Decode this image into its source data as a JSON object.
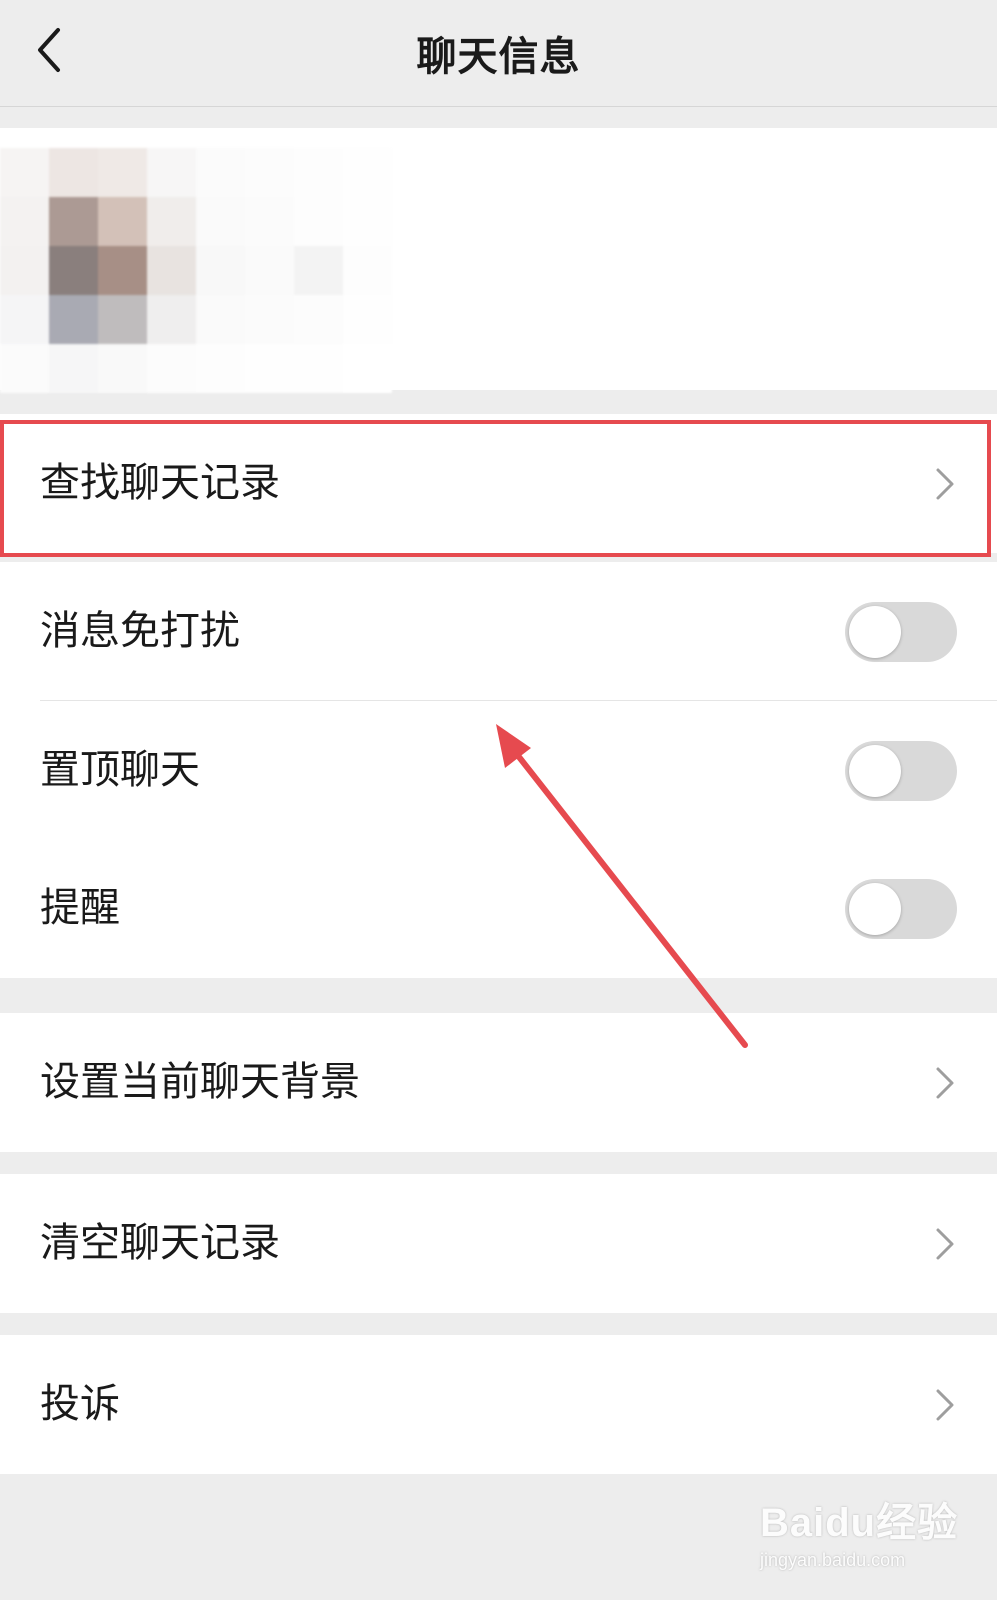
{
  "header": {
    "title": "聊天信息",
    "back_icon": "chevron-left-icon"
  },
  "rows": {
    "search_history": {
      "label": "查找聊天记录"
    },
    "mute": {
      "label": "消息免打扰",
      "enabled": false
    },
    "pin": {
      "label": "置顶聊天",
      "enabled": false
    },
    "remind": {
      "label": "提醒",
      "enabled": false
    },
    "background": {
      "label": "设置当前聊天背景"
    },
    "clear_history": {
      "label": "清空聊天记录"
    },
    "complain": {
      "label": "投诉"
    }
  },
  "annotation": {
    "color": "#e64a4f"
  },
  "watermark": {
    "logo": "Baidu经验",
    "url": "jingyan.baidu.com"
  }
}
